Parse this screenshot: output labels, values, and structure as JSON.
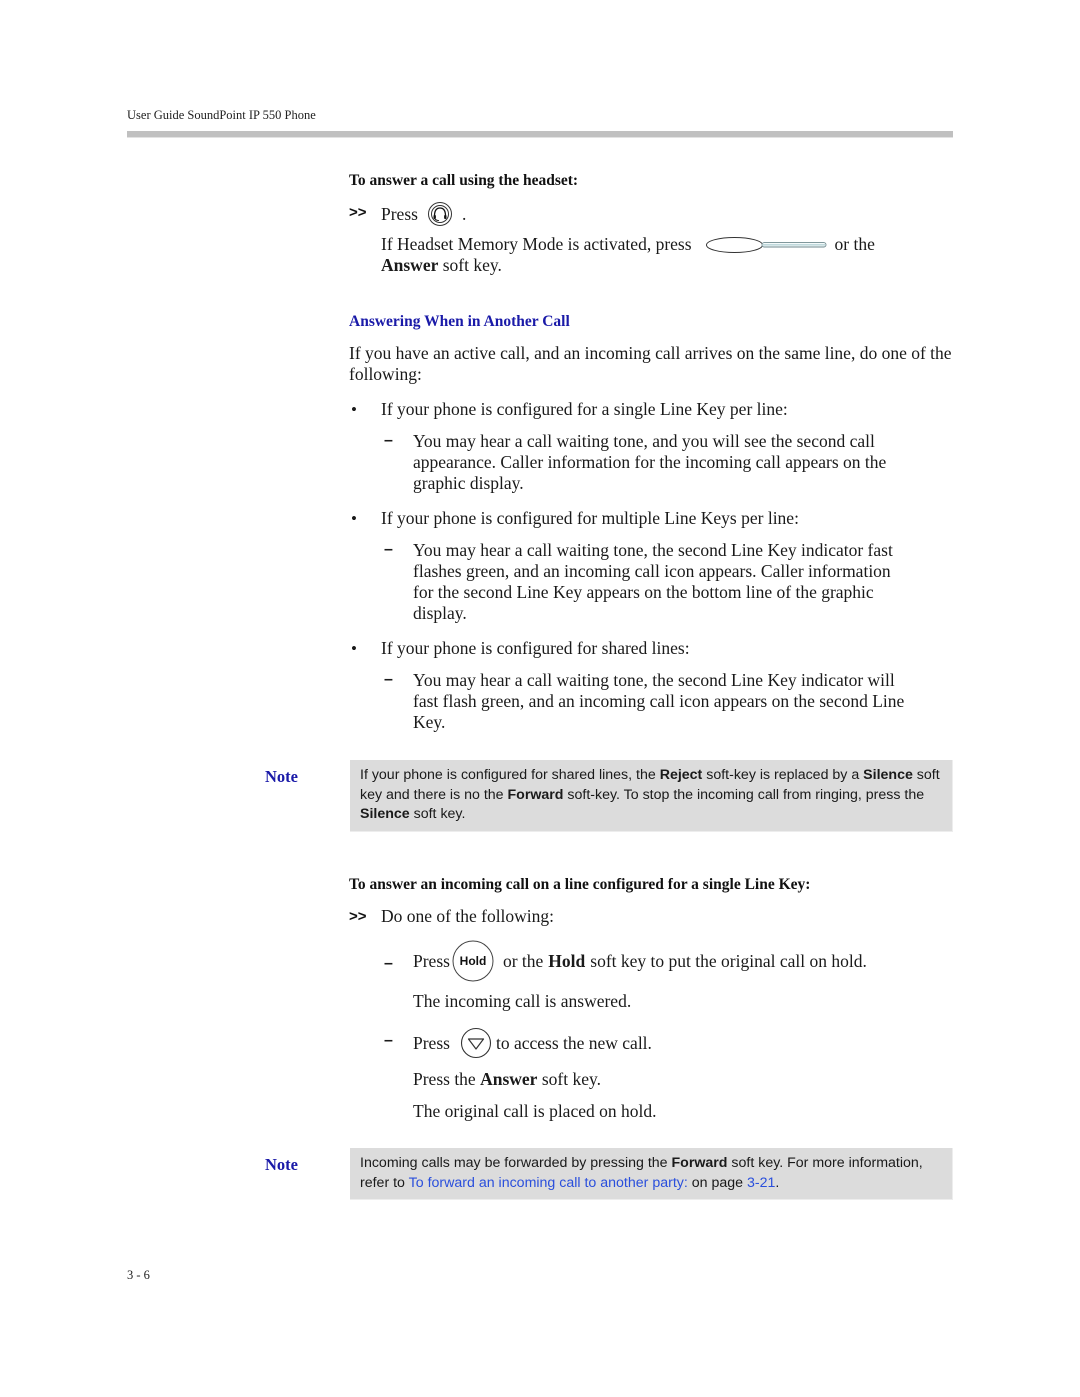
{
  "header": {
    "title": "User Guide SoundPoint IP 550 Phone"
  },
  "headset_procedure": {
    "title": "To answer a call using the headset:",
    "step_marker": ">>",
    "step_press": "Press",
    "step_period": ".",
    "headset_icon": "headset-icon",
    "memory_text_before": "If Headset Memory Mode is activated, press",
    "line_key_icon": "line-key-icon",
    "memory_text_after": "or the",
    "answer_label": "Answer",
    "soft_key_suffix": "soft key."
  },
  "section": {
    "heading": "Answering When in Another Call",
    "intro": "If you have an active call, and an incoming call arrives on the same line, do one of the following:",
    "bullets": [
      {
        "marker": "•",
        "text": "If your phone is configured for a single Line Key per line:",
        "sub": {
          "marker": "–",
          "lines": [
            "You may hear a call waiting tone, and you will see the second call",
            "appearance. Caller information for the incoming call appears on the",
            "graphic display."
          ]
        }
      },
      {
        "marker": "•",
        "text": "If your phone is configured for multiple Line Keys per line:",
        "sub": {
          "marker": "–",
          "lines": [
            "You may hear a call waiting tone, the second Line Key indicator fast",
            "flashes green, and an incoming call icon appears. Caller information",
            "for the second Line Key appears on the bottom line of the graphic",
            "display."
          ]
        }
      },
      {
        "marker": "•",
        "text": "If your phone is configured for shared lines:",
        "sub": {
          "marker": "–",
          "lines": [
            "You may hear a call waiting tone, the second Line Key indicator will",
            "fast flash green, and an incoming call icon appears on the second Line",
            "Key."
          ]
        }
      }
    ]
  },
  "note1": {
    "label": "Note",
    "t1": "If your phone is configured for shared lines, the ",
    "b1": "Reject",
    "t2": " soft-key is replaced by a ",
    "b2": "Silence",
    "t3": " soft key and there is no the ",
    "b3": "Forward",
    "t4": " soft-key. To stop the incoming call from ringing, press the ",
    "b4": "Silence",
    "t5": " soft key."
  },
  "single_key_procedure": {
    "title": "To answer an incoming call on a line configured for a single Line Key:",
    "step_marker": ">>",
    "step_text": "Do one of the following:",
    "options": [
      {
        "marker": "–",
        "press": "Press",
        "icon": "hold-key-icon",
        "icon_label": "Hold",
        "text_before": "or the",
        "bold": "Hold",
        "text_after": "soft key to put the original call on hold.",
        "result": "The incoming call is answered."
      },
      {
        "marker": "–",
        "press": "Press",
        "icon": "down-arrow-key-icon",
        "text_after": "to access the new call.",
        "follow_before": "Press the",
        "follow_bold": "Answer",
        "follow_after": "soft key.",
        "result": "The original call is placed on hold."
      }
    ]
  },
  "note2": {
    "label": "Note",
    "t1": "Incoming calls may be forwarded by pressing the ",
    "b1": "Forward",
    "t2": " soft key. For more information, refer to ",
    "link_text": "To forward an incoming call to another party:",
    "t3": " on page ",
    "page_link": "3-21",
    "t4": "."
  },
  "footer": {
    "page_number": "3 - 6"
  },
  "colors": {
    "heading_blue": "#1a1aa8",
    "link_blue": "#2a4fdc",
    "note_bg": "#dcdcdc",
    "rule_gray": "#c0c0c0"
  }
}
